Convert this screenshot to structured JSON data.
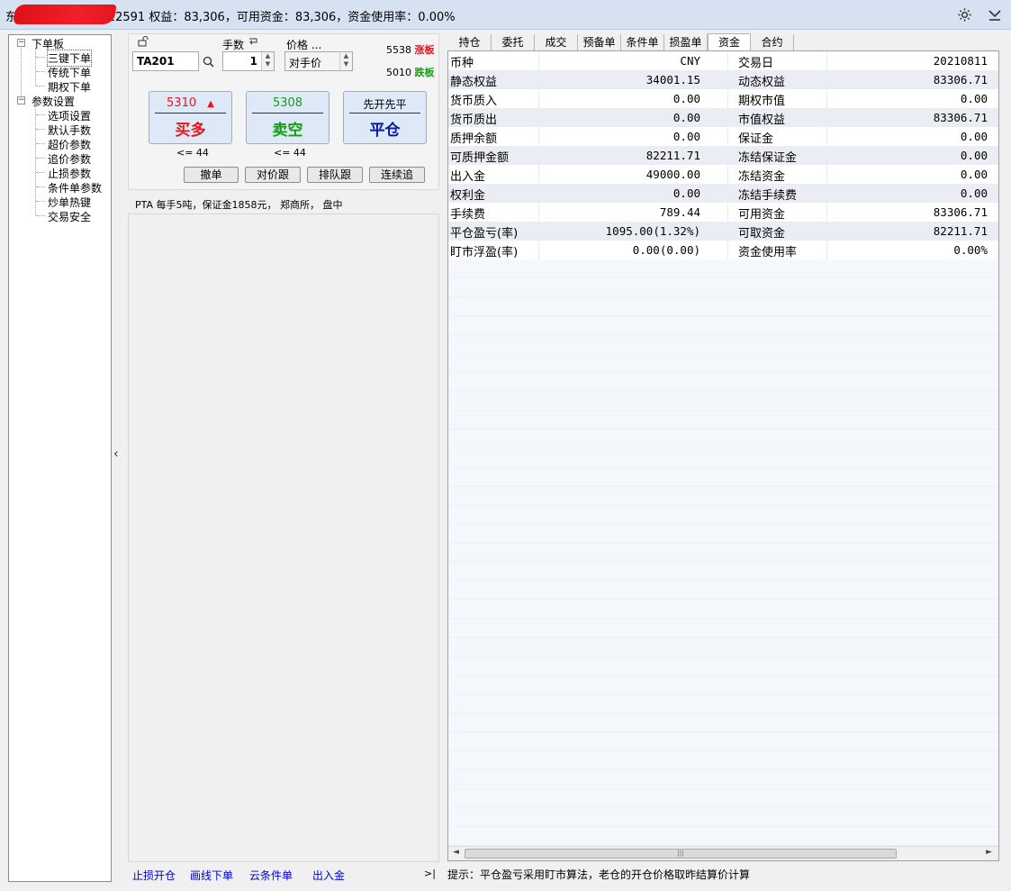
{
  "titlebar": {
    "account_suffix": "20022591",
    "summary": "权益：83,306，可用资金：83,306，资金使用率：0.00%",
    "prefix": "东",
    "settings_icon": "gear-icon",
    "menu_icon": "chevron-down-icon"
  },
  "tree": {
    "groups": [
      {
        "label": "下单板",
        "toggle": "−",
        "items": [
          "三键下单",
          "传统下单",
          "期权下单"
        ]
      },
      {
        "label": "参数设置",
        "toggle": "−",
        "items": [
          "选项设置",
          "默认手数",
          "超价参数",
          "追价参数",
          "止损参数",
          "条件单参数",
          "炒单热键",
          "交易安全"
        ]
      }
    ]
  },
  "order": {
    "lock_icon": "lock-icon",
    "contract": "TA201",
    "qty_label": "手数",
    "qty_value": "1",
    "price_label": "价格 ...",
    "price_value": "对手价",
    "limit_up": "5538",
    "limit_up_label": "涨板",
    "limit_down": "5010",
    "limit_down_label": "跌板",
    "buy_price": "5310",
    "buy_label": "买多",
    "buy_limit": "<= 44",
    "sell_price": "5308",
    "sell_label": "卖空",
    "sell_limit": "<= 44",
    "close_mode": "先开先平",
    "close_label": "平仓",
    "btn_cancel": "撤单",
    "btn_follow_counter": "对价跟",
    "btn_follow_queue": "排队跟",
    "btn_continuous": "连续追",
    "info": "PTA  每手5吨，保证金1858元， 郑商所， 盘中"
  },
  "bottom_links": [
    "止损开仓",
    "画线下单",
    "云条件单",
    "出入金"
  ],
  "tabs": [
    "持仓",
    "委托",
    "成交",
    "预备单",
    "条件单",
    "损盈单",
    "资金",
    "合约"
  ],
  "active_tab": "资金",
  "funds": [
    [
      "币种",
      "CNY",
      "交易日",
      "20210811"
    ],
    [
      "静态权益",
      "34001.15",
      "动态权益",
      "83306.71"
    ],
    [
      "货币质入",
      "0.00",
      "期权市值",
      "0.00"
    ],
    [
      "货币质出",
      "0.00",
      "市值权益",
      "83306.71"
    ],
    [
      "质押余额",
      "0.00",
      "保证金",
      "0.00"
    ],
    [
      "可质押金额",
      "82211.71",
      "冻结保证金",
      "0.00"
    ],
    [
      "出入金",
      "49000.00",
      "冻结资金",
      "0.00"
    ],
    [
      "权利金",
      "0.00",
      "冻结手续费",
      "0.00"
    ],
    [
      "手续费",
      "789.44",
      "可用资金",
      "83306.71"
    ],
    [
      "平仓盈亏(率)",
      "1095.00(1.32%)",
      "可取资金",
      "82211.71"
    ],
    [
      "盯市浮盈(率)",
      "0.00(0.00)",
      "资金使用率",
      "0.00%"
    ]
  ],
  "tip": "提示：平仓盈亏采用盯市算法，老仓的开仓价格取昨结算价计算",
  "colors": {
    "buy": "#e8141c",
    "sell": "#1a9a1a",
    "close": "#0a1aa0",
    "link": "#0000cc"
  }
}
